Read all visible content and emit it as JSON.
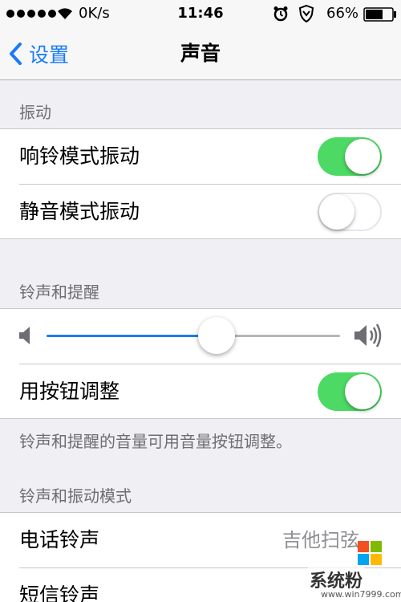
{
  "status_bar": {
    "net_speed": "0K/s",
    "time": "11:46",
    "battery_percent": "66%",
    "battery_level": 0.66,
    "icons": [
      "signal-dots",
      "wifi-icon",
      "alarm-icon",
      "shield-icon",
      "battery-icon"
    ]
  },
  "nav": {
    "back_label": "设置",
    "title": "声音"
  },
  "sections": {
    "vibrate": {
      "header": "振动",
      "rows": [
        {
          "label": "响铃模式振动",
          "toggle": "on"
        },
        {
          "label": "静音模式振动",
          "toggle": "off"
        }
      ]
    },
    "ringer": {
      "header": "铃声和提醒",
      "volume_level": 0.58,
      "change_with_buttons": {
        "label": "用按钮调整",
        "toggle": "on"
      },
      "footer": "铃声和提醒的音量可用音量按钮调整。"
    },
    "patterns": {
      "header": "铃声和振动模式",
      "rows": [
        {
          "label": "电话铃声",
          "value": "吉他扫弦"
        },
        {
          "label": "短信铃声",
          "value": ""
        }
      ]
    }
  },
  "colors": {
    "accent": "#1a7cf5",
    "toggle_on": "#4cd964",
    "background": "#efeff4"
  },
  "watermark": {
    "text": "系统粉",
    "url": "www.win7999.com"
  }
}
